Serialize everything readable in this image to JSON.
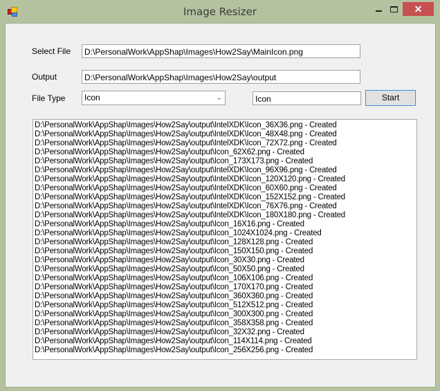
{
  "window": {
    "title": "Image Resizer",
    "close_glyph": "✕"
  },
  "form": {
    "select_file": {
      "label": "Select File",
      "value": "D:\\PersonalWork\\AppShap\\Images\\How2Say\\MainIcon.png"
    },
    "output": {
      "label": "Output",
      "value": "D:\\PersonalWork\\AppShap\\Images\\How2Say\\output"
    },
    "file_type": {
      "label": "File Type",
      "selected": "Icon",
      "name_value": "Icon"
    },
    "start_label": "Start"
  },
  "log": [
    "D:\\PersonalWork\\AppShap\\Images\\How2Say\\output\\IntelXDK\\Icon_36X36.png - Created",
    "D:\\PersonalWork\\AppShap\\Images\\How2Say\\output\\IntelXDK\\Icon_48X48.png - Created",
    "D:\\PersonalWork\\AppShap\\Images\\How2Say\\output\\IntelXDK\\Icon_72X72.png - Created",
    "D:\\PersonalWork\\AppShap\\Images\\How2Say\\output\\Icon_62X62.png - Created",
    "D:\\PersonalWork\\AppShap\\Images\\How2Say\\output\\Icon_173X173.png - Created",
    "D:\\PersonalWork\\AppShap\\Images\\How2Say\\output\\IntelXDK\\Icon_96X96.png - Created",
    "D:\\PersonalWork\\AppShap\\Images\\How2Say\\output\\IntelXDK\\Icon_120X120.png - Created",
    "D:\\PersonalWork\\AppShap\\Images\\How2Say\\output\\IntelXDK\\Icon_60X60.png - Created",
    "D:\\PersonalWork\\AppShap\\Images\\How2Say\\output\\IntelXDK\\Icon_152X152.png - Created",
    "D:\\PersonalWork\\AppShap\\Images\\How2Say\\output\\IntelXDK\\Icon_76X76.png - Created",
    "D:\\PersonalWork\\AppShap\\Images\\How2Say\\output\\IntelXDK\\Icon_180X180.png - Created",
    "D:\\PersonalWork\\AppShap\\Images\\How2Say\\output\\Icon_16X16.png - Created",
    "D:\\PersonalWork\\AppShap\\Images\\How2Say\\output\\Icon_1024X1024.png - Created",
    "D:\\PersonalWork\\AppShap\\Images\\How2Say\\output\\Icon_128X128.png - Created",
    "D:\\PersonalWork\\AppShap\\Images\\How2Say\\output\\Icon_150X150.png - Created",
    "D:\\PersonalWork\\AppShap\\Images\\How2Say\\output\\Icon_30X30.png - Created",
    "D:\\PersonalWork\\AppShap\\Images\\How2Say\\output\\Icon_50X50.png - Created",
    "D:\\PersonalWork\\AppShap\\Images\\How2Say\\output\\Icon_106X106.png - Created",
    "D:\\PersonalWork\\AppShap\\Images\\How2Say\\output\\Icon_170X170.png - Created",
    "D:\\PersonalWork\\AppShap\\Images\\How2Say\\output\\Icon_360X360.png - Created",
    "D:\\PersonalWork\\AppShap\\Images\\How2Say\\output\\Icon_512X512.png - Created",
    "D:\\PersonalWork\\AppShap\\Images\\How2Say\\output\\Icon_300X300.png - Created",
    "D:\\PersonalWork\\AppShap\\Images\\How2Say\\output\\Icon_358X358.png - Created",
    "D:\\PersonalWork\\AppShap\\Images\\How2Say\\output\\Icon_32X32.png - Created",
    "D:\\PersonalWork\\AppShap\\Images\\How2Say\\output\\Icon_114X114.png - Created",
    "D:\\PersonalWork\\AppShap\\Images\\How2Say\\output\\Icon_256X256.png - Created"
  ],
  "colors": {
    "titlebar": "#b4c2a0",
    "close_button": "#c75050",
    "client_bg": "#f0f0f0",
    "button_focus_border": "#3c8fe0"
  }
}
